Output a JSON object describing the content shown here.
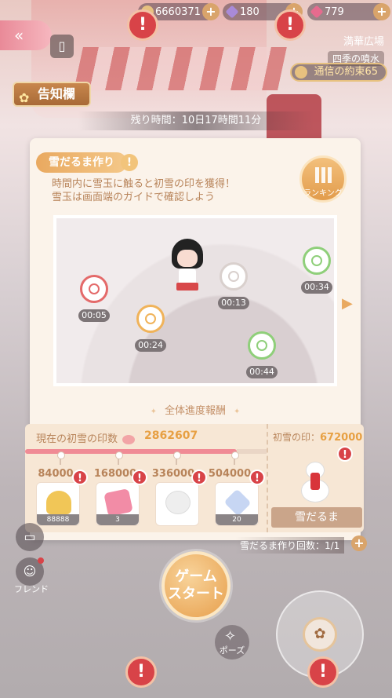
{
  "currency": {
    "coins": "6660371",
    "diamonds": "180",
    "gems": "779"
  },
  "location": {
    "name": "満華広場",
    "sub": "四季の噴水"
  },
  "promise": "通信の約束65",
  "notice": "告知欄",
  "timer": "残り時間：10日17時間11分",
  "panel": {
    "title": "雪だるま作り",
    "desc_line1": "時間内に雪玉に触ると初雪の印を獲得！",
    "desc_line2": "雪玉は画面端のガイドで確認しよう",
    "ranking": "ランキング",
    "targets": [
      "00:05",
      "00:24",
      "00:13",
      "00:34",
      "00:44"
    ],
    "progress_title": "全体進度報酬"
  },
  "rewards": {
    "label": "現在の初雪の印数",
    "value": "2862607",
    "milestones": [
      "84000",
      "168000",
      "336000",
      "504000"
    ],
    "counts": [
      "88888",
      "3",
      "",
      "20"
    ]
  },
  "snowman": {
    "label": "初雪の印：",
    "value": "672000",
    "name": "雪だるま"
  },
  "count_line": "雪だるま作り回数：1/1",
  "start": {
    "line1": "ゲーム",
    "line2": "スタート"
  },
  "side": {
    "friend": "フレンド",
    "pose": "ポーズ"
  },
  "colors": {
    "accent": "#e9a960",
    "alert": "#d84348",
    "progress": "#f08b95"
  }
}
